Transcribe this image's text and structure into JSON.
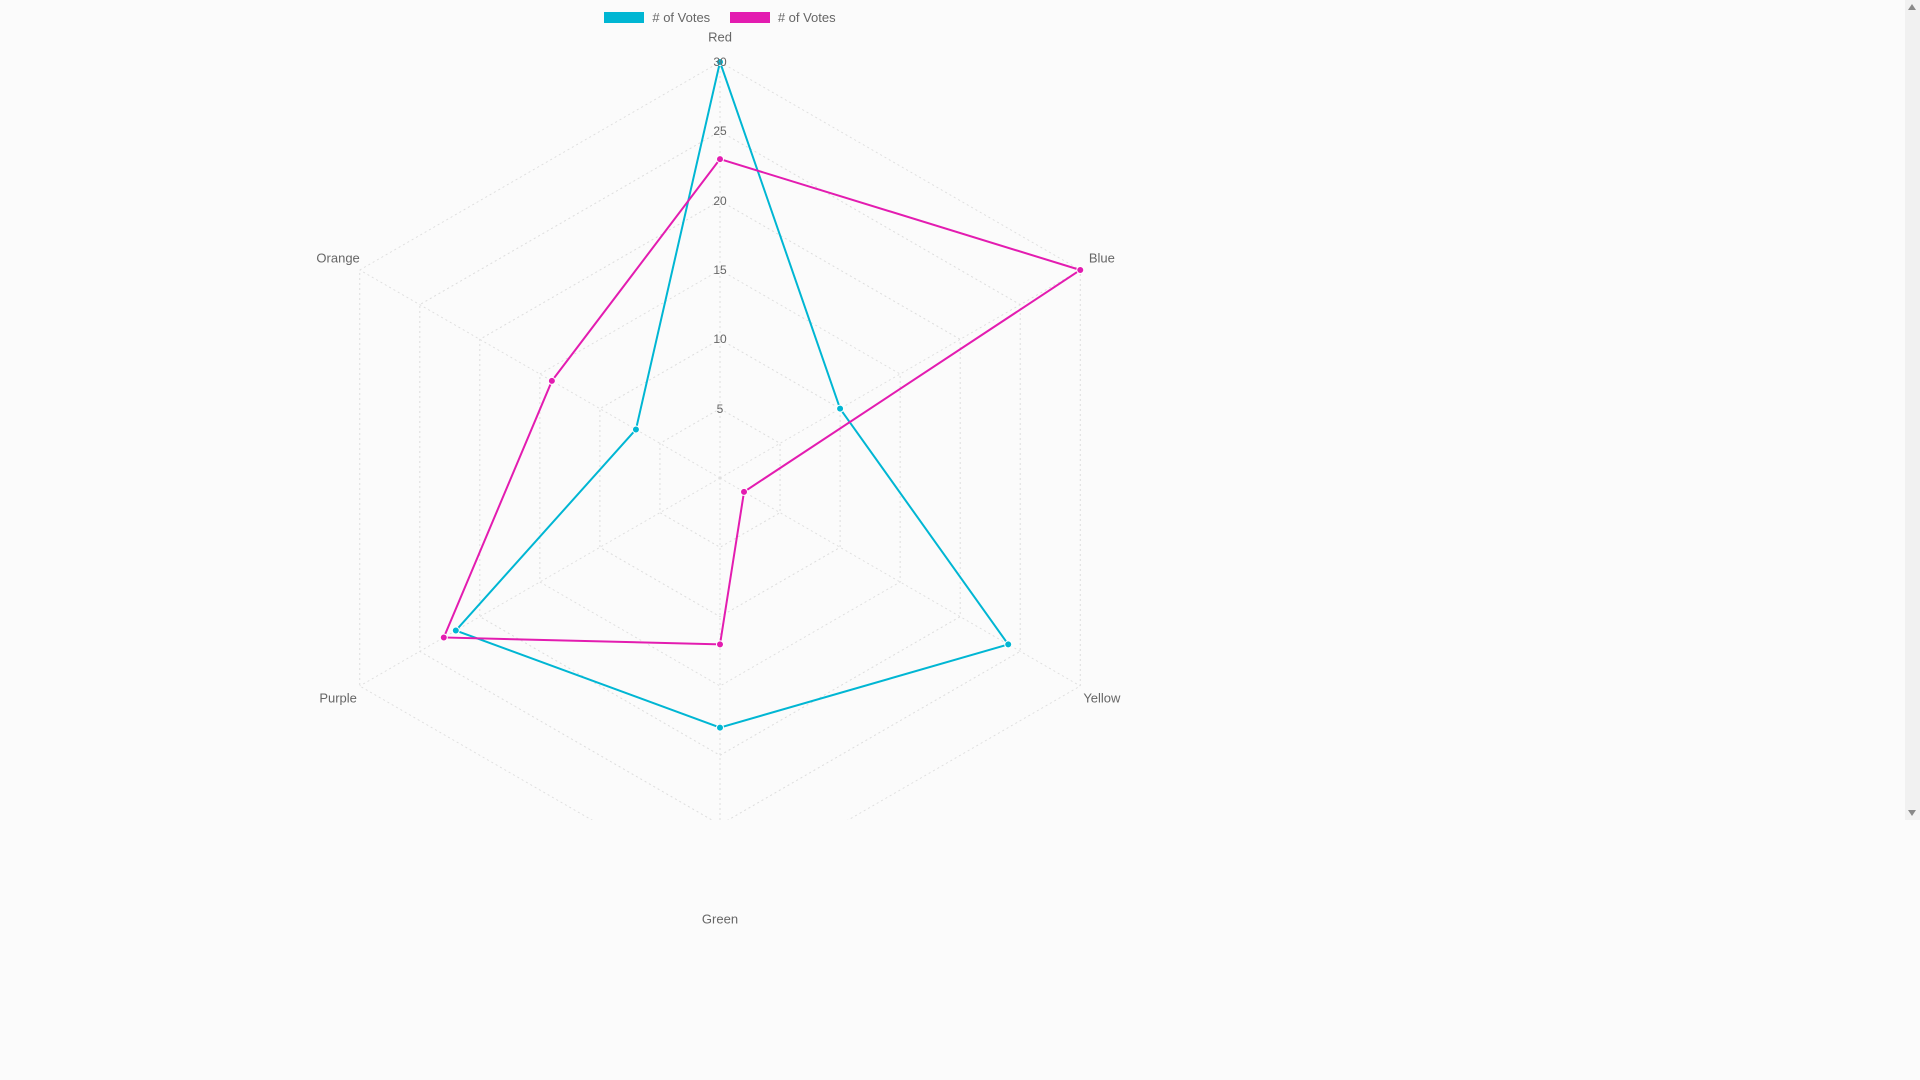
{
  "chart_data": {
    "type": "radar",
    "categories": [
      "Red",
      "Blue",
      "Yellow",
      "Green",
      "Purple",
      "Orange"
    ],
    "series": [
      {
        "name": "# of Votes",
        "color": "#00b6d3",
        "values": [
          30,
          10,
          24,
          18,
          22,
          7
        ]
      },
      {
        "name": "# of Votes",
        "color": "#e31cb0",
        "values": [
          23,
          30,
          2,
          12,
          23,
          14
        ]
      }
    ],
    "ticks": [
      5,
      10,
      15,
      20,
      25,
      30
    ],
    "max": 30,
    "title": "",
    "legend_position": "top"
  },
  "legend": {
    "items": [
      {
        "label": "# of Votes",
        "color": "#00b6d3"
      },
      {
        "label": "# of Votes",
        "color": "#e31cb0"
      }
    ]
  }
}
